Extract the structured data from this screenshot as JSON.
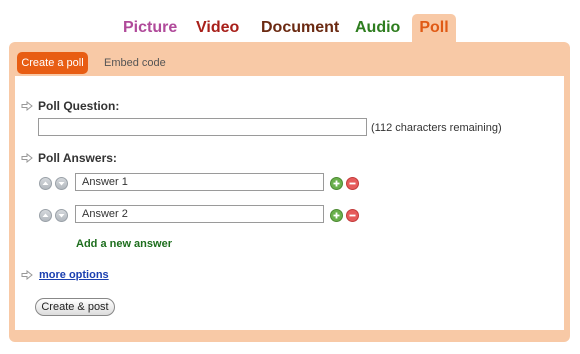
{
  "top_tabs": {
    "picture": "Picture",
    "video": "Video",
    "document": "Document",
    "audio": "Audio",
    "poll": "Poll"
  },
  "sub_tabs": {
    "create": "Create a poll",
    "embed": "Embed code"
  },
  "form": {
    "question_label": "Poll Question:",
    "question_value": "",
    "remaining_hint": "(112 characters remaining)",
    "answers_label": "Poll Answers:",
    "answers": [
      {
        "value": "Answer 1"
      },
      {
        "value": "Answer 2"
      }
    ],
    "add_answer": "Add a new answer",
    "more_options": "more options",
    "submit": "Create & post"
  },
  "colors": {
    "accent": "#e85d13",
    "panel": "#f8c9a6"
  },
  "icons": [
    "arrow-right-icon",
    "arrow-up-icon",
    "arrow-down-icon",
    "plus-icon",
    "minus-icon"
  ]
}
